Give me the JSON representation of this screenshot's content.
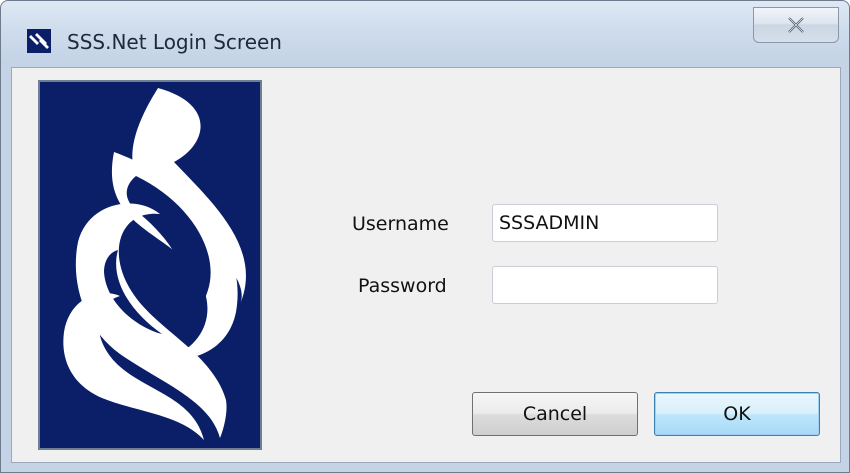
{
  "window": {
    "title": "SSS.Net Login Screen",
    "title_icon": "sss-logo-icon",
    "close_icon": "close-icon"
  },
  "logo": {
    "name": "sss-logo",
    "background_color": "#0a1f68"
  },
  "form": {
    "username_label": "Username",
    "username_value": "SSSADMIN",
    "password_label": "Password",
    "password_value": ""
  },
  "buttons": {
    "cancel_label": "Cancel",
    "ok_label": "OK"
  },
  "colors": {
    "titlebar": "#cfdcec",
    "client_background": "#f0f0f0",
    "logo_navy": "#0a1f68",
    "ok_highlight": "#3c7fb1"
  }
}
